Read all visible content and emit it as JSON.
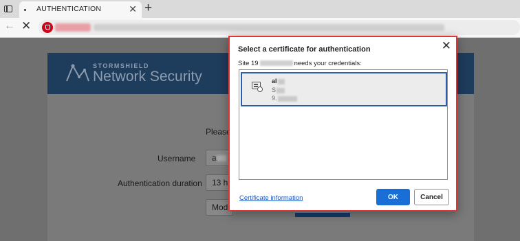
{
  "browser": {
    "tab_title": "AUTHENTICATION",
    "new_tab_symbol": "+",
    "tab_close_symbol": "✕",
    "back_symbol": "←",
    "stop_symbol": "✕"
  },
  "page": {
    "brand_small": "STORMSHIELD",
    "brand_main": "Network Security",
    "prompt_partial": "Please",
    "username_label": "Username",
    "username_value_partial": "a",
    "duration_label": "Authentication duration",
    "duration_value_partial": "13 h",
    "modify_partial": "Modi"
  },
  "dialog": {
    "title": "Select a certificate for authentication",
    "close_symbol": "✕",
    "site_prefix": "Site 19",
    "site_suffix": "needs your credentials:",
    "certificate": {
      "line1": "al",
      "line2": "S",
      "line3": "9."
    },
    "info_link": "Certificate information",
    "ok_label": "OK",
    "cancel_label": "Cancel"
  },
  "colors": {
    "accent": "#1a6fd6",
    "dialog_border": "#d93838",
    "banner": "#1e3c5c",
    "security_icon": "#d0021b"
  }
}
